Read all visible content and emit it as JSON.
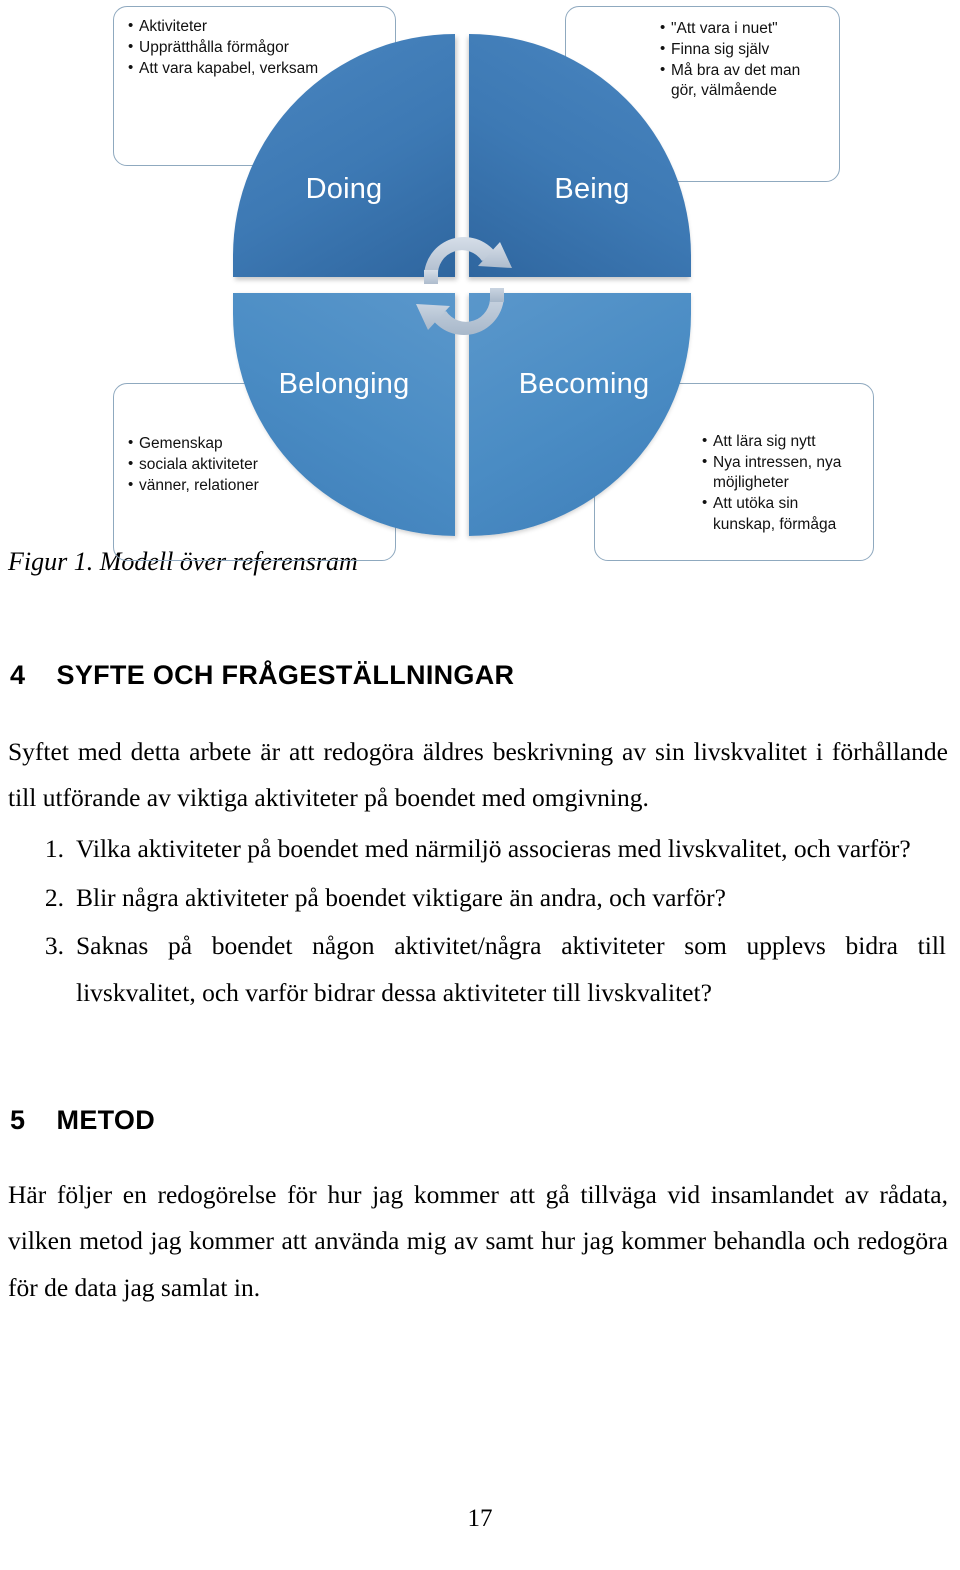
{
  "figure": {
    "caption": "Figur 1. Modell över referensram",
    "circle": {
      "quadrants": [
        {
          "key": "doing",
          "label": "Doing",
          "color": "#3d79b4"
        },
        {
          "key": "being",
          "label": "Being",
          "color": "#3d79b4"
        },
        {
          "key": "belonging",
          "label": "Belonging",
          "color": "#4a8cc4"
        },
        {
          "key": "becoming",
          "label": "Becoming",
          "color": "#4a8cc4"
        }
      ],
      "center_icon": "cycle-arrows-icon",
      "center_icon_color": "#c3cedb"
    },
    "callouts": {
      "doing": {
        "items": [
          "Aktiviteter",
          "Upprätthålla förmågor",
          "Att vara kapabel, verksam"
        ]
      },
      "being": {
        "items": [
          "\"Att vara i nuet\"",
          "Finna sig själv",
          "Må bra av det man gör, välmående"
        ]
      },
      "belonging": {
        "items": [
          "Gemenskap",
          "sociala aktiviteter",
          "vänner, relationer"
        ]
      },
      "becoming": {
        "items": [
          "Att lära sig nytt",
          "Nya intressen, nya möjligheter",
          "Att utöka sin kunskap, förmåga"
        ]
      }
    },
    "callout_border_color": "#8fa9bf"
  },
  "sections": {
    "syfte": {
      "number": "4",
      "title": "SYFTE OCH FRÅGESTÄLLNINGAR",
      "heading_full": "4    SYFTE OCH FRÅGESTÄLLNINGAR",
      "paragraph": "Syftet med detta arbete är att redogöra äldres beskrivning av sin livskvalitet i förhållande till utförande av viktiga aktiviteter på boendet med omgivning.",
      "questions": [
        {
          "num": "1.",
          "text": "Vilka aktiviteter på boendet med närmiljö associeras med livskvalitet, och varför?"
        },
        {
          "num": "2.",
          "text": "Blir några aktiviteter på boendet viktigare än andra, och varför?"
        },
        {
          "num": "3.",
          "text": "Saknas på boendet någon aktivitet/några aktiviteter som upplevs bidra till livskvalitet, och varför bidrar dessa aktiviteter till livskvalitet?"
        }
      ]
    },
    "metod": {
      "number": "5",
      "title": "METOD",
      "heading_full": "5    METOD",
      "paragraph": "Här följer en redogörelse för hur jag kommer att gå tillväga vid insamlandet av rådata, vilken metod jag kommer att använda mig av samt hur jag kommer behandla och redogöra för de data jag samlat in."
    }
  },
  "footer": {
    "page_number": "17"
  }
}
